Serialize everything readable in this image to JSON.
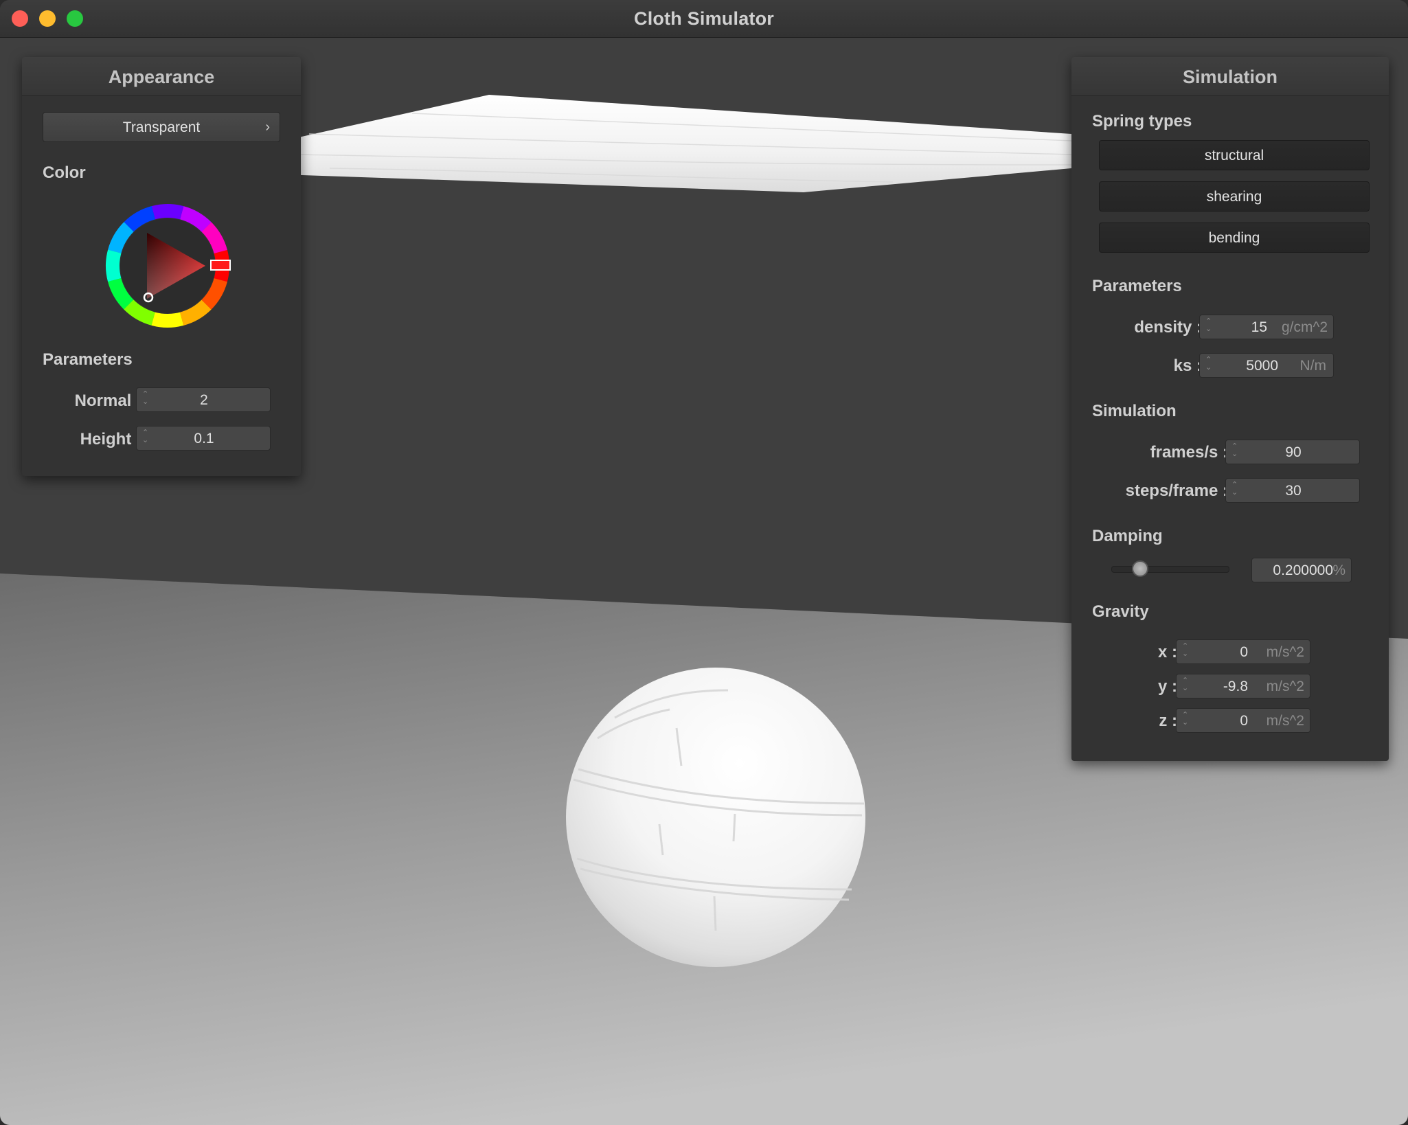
{
  "window": {
    "title": "Cloth Simulator"
  },
  "appearance": {
    "title": "Appearance",
    "shader_select": "Transparent",
    "chevron": "›",
    "color_label": "Color",
    "parameters_label": "Parameters",
    "normal_label": "Normal :",
    "normal_value": "2",
    "height_label": "Height :",
    "height_value": "0.1",
    "hue_color": "#ff1a1a"
  },
  "simulation": {
    "title": "Simulation",
    "spring_types_label": "Spring types",
    "spring_buttons": [
      "structural",
      "shearing",
      "bending"
    ],
    "parameters_label": "Parameters",
    "density_label": "density :",
    "density_value": "15",
    "density_unit": "g/cm^2",
    "ks_label": "ks :",
    "ks_value": "5000",
    "ks_unit": "N/m",
    "simulation_label": "Simulation",
    "fps_label": "frames/s :",
    "fps_value": "90",
    "steps_label": "steps/frame :",
    "steps_value": "30",
    "damping_label": "Damping",
    "damping_fraction": 0.2,
    "damping_value": "0.200000",
    "damping_unit": "%",
    "gravity_label": "Gravity",
    "gx_label": "x :",
    "gx_value": "0",
    "gy_label": "y :",
    "gy_value": "-9.8",
    "gz_label": "z :",
    "gz_value": "0",
    "gravity_unit": "m/s^2"
  },
  "spinner_glyph": "⌃⌄"
}
